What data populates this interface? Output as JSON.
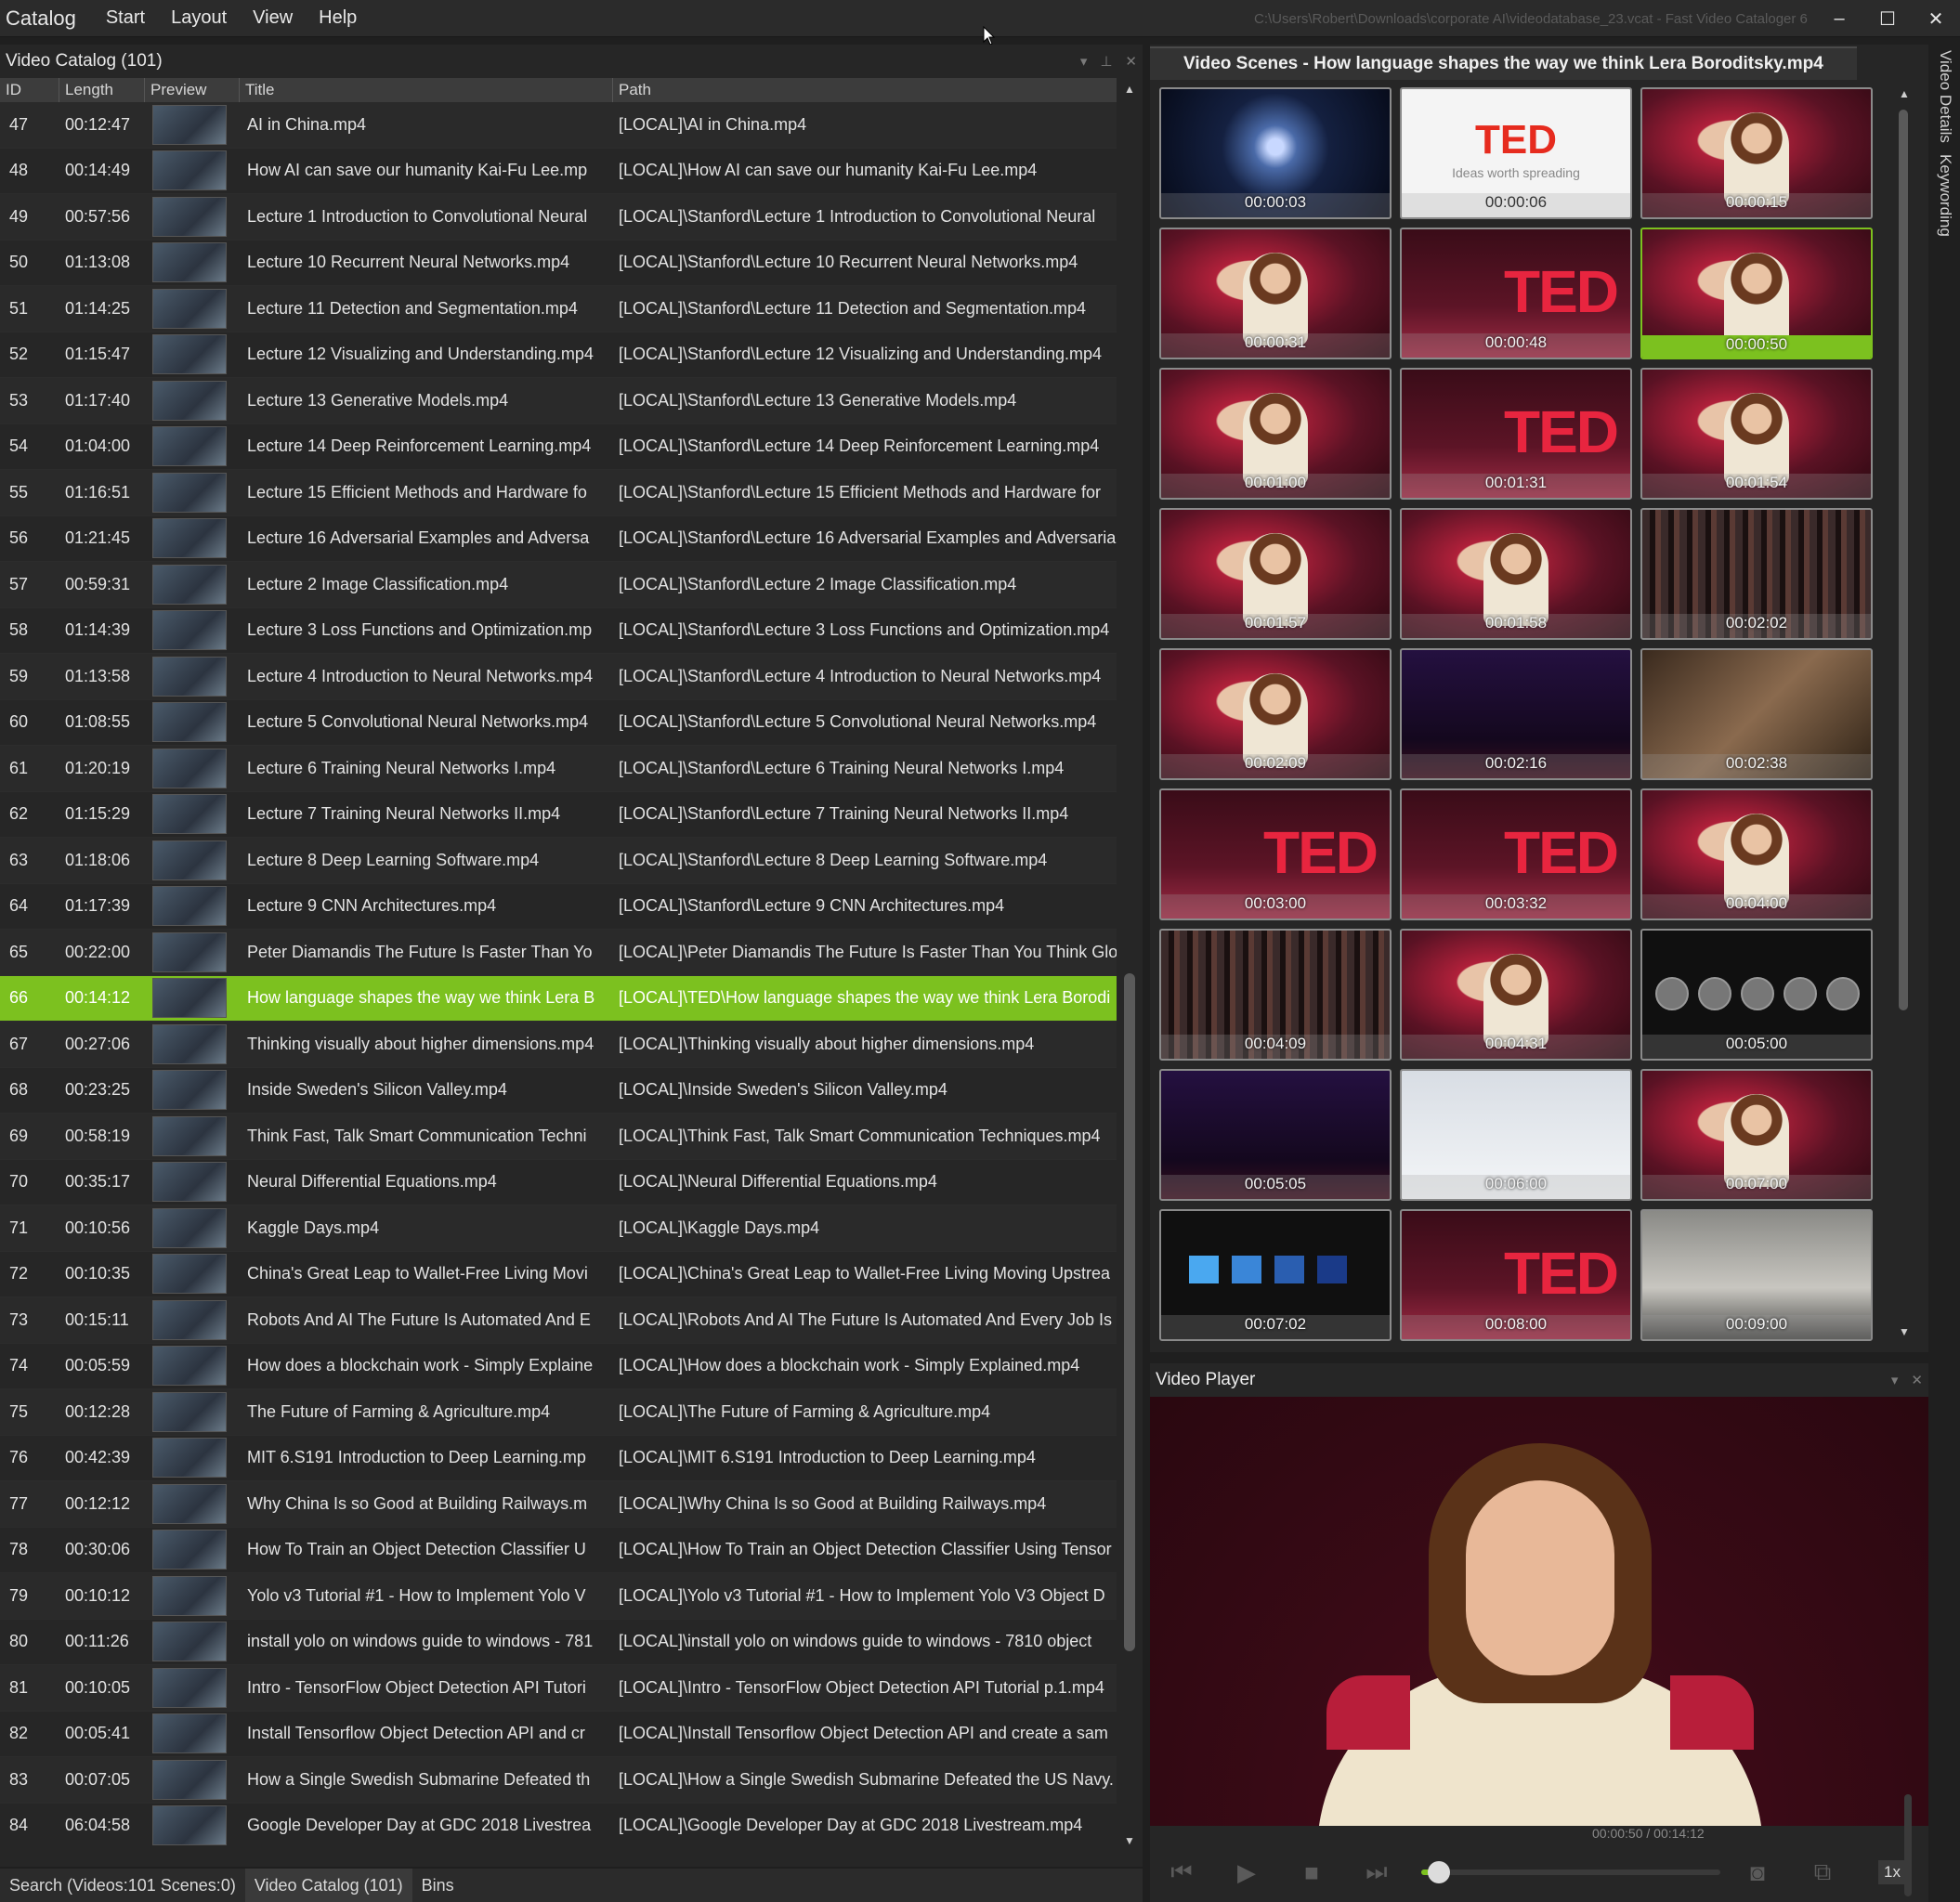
{
  "menu": {
    "items": [
      "Catalog",
      "Start",
      "Layout",
      "View",
      "Help"
    ]
  },
  "window": {
    "title_path": "C:\\Users\\Robert\\Downloads\\corporate AI\\videodatabase_23.vcat - Fast Video Cataloger 6",
    "minimize": "–",
    "maximize": "☐",
    "close": "✕"
  },
  "catalog": {
    "title": "Video Catalog (101)",
    "columns": [
      "ID",
      "Length",
      "Preview",
      "Title",
      "Path"
    ],
    "rows": [
      {
        "id": "47",
        "length": "00:12:47",
        "title": "AI in China.mp4",
        "path": "[LOCAL]\\AI in China.mp4"
      },
      {
        "id": "48",
        "length": "00:14:49",
        "title": "How AI can save our humanity Kai-Fu Lee.mp",
        "path": "[LOCAL]\\How AI can save our humanity Kai-Fu Lee.mp4"
      },
      {
        "id": "49",
        "length": "00:57:56",
        "title": "Lecture 1 Introduction to Convolutional Neural",
        "path": "[LOCAL]\\Stanford\\Lecture 1 Introduction to Convolutional Neural"
      },
      {
        "id": "50",
        "length": "01:13:08",
        "title": "Lecture 10 Recurrent Neural Networks.mp4",
        "path": "[LOCAL]\\Stanford\\Lecture 10 Recurrent Neural Networks.mp4"
      },
      {
        "id": "51",
        "length": "01:14:25",
        "title": "Lecture 11 Detection and Segmentation.mp4",
        "path": "[LOCAL]\\Stanford\\Lecture 11 Detection and Segmentation.mp4"
      },
      {
        "id": "52",
        "length": "01:15:47",
        "title": "Lecture 12 Visualizing and Understanding.mp4",
        "path": "[LOCAL]\\Stanford\\Lecture 12 Visualizing and Understanding.mp4"
      },
      {
        "id": "53",
        "length": "01:17:40",
        "title": "Lecture 13 Generative Models.mp4",
        "path": "[LOCAL]\\Stanford\\Lecture 13 Generative Models.mp4"
      },
      {
        "id": "54",
        "length": "01:04:00",
        "title": "Lecture 14 Deep Reinforcement Learning.mp4",
        "path": "[LOCAL]\\Stanford\\Lecture 14 Deep Reinforcement Learning.mp4"
      },
      {
        "id": "55",
        "length": "01:16:51",
        "title": "Lecture 15 Efficient Methods and Hardware fo",
        "path": "[LOCAL]\\Stanford\\Lecture 15 Efficient Methods and Hardware for"
      },
      {
        "id": "56",
        "length": "01:21:45",
        "title": "Lecture 16 Adversarial Examples and Adversa",
        "path": "[LOCAL]\\Stanford\\Lecture 16 Adversarial Examples and Adversaria"
      },
      {
        "id": "57",
        "length": "00:59:31",
        "title": "Lecture 2 Image Classification.mp4",
        "path": "[LOCAL]\\Stanford\\Lecture 2 Image Classification.mp4"
      },
      {
        "id": "58",
        "length": "01:14:39",
        "title": "Lecture 3 Loss Functions and Optimization.mp",
        "path": "[LOCAL]\\Stanford\\Lecture 3 Loss Functions and Optimization.mp4"
      },
      {
        "id": "59",
        "length": "01:13:58",
        "title": "Lecture 4 Introduction to Neural Networks.mp4",
        "path": "[LOCAL]\\Stanford\\Lecture 4 Introduction to Neural Networks.mp4"
      },
      {
        "id": "60",
        "length": "01:08:55",
        "title": "Lecture 5 Convolutional Neural Networks.mp4",
        "path": "[LOCAL]\\Stanford\\Lecture 5 Convolutional Neural Networks.mp4"
      },
      {
        "id": "61",
        "length": "01:20:19",
        "title": "Lecture 6 Training Neural Networks I.mp4",
        "path": "[LOCAL]\\Stanford\\Lecture 6 Training Neural Networks I.mp4"
      },
      {
        "id": "62",
        "length": "01:15:29",
        "title": "Lecture 7 Training Neural Networks II.mp4",
        "path": "[LOCAL]\\Stanford\\Lecture 7 Training Neural Networks II.mp4"
      },
      {
        "id": "63",
        "length": "01:18:06",
        "title": "Lecture 8 Deep Learning Software.mp4",
        "path": "[LOCAL]\\Stanford\\Lecture 8 Deep Learning Software.mp4"
      },
      {
        "id": "64",
        "length": "01:17:39",
        "title": "Lecture 9 CNN Architectures.mp4",
        "path": "[LOCAL]\\Stanford\\Lecture 9 CNN Architectures.mp4"
      },
      {
        "id": "65",
        "length": "00:22:00",
        "title": "Peter Diamandis The Future Is Faster Than Yo",
        "path": "[LOCAL]\\Peter Diamandis The Future Is Faster Than You Think Glo"
      },
      {
        "id": "66",
        "length": "00:14:12",
        "title": "How language shapes the way we think Lera B",
        "path": "[LOCAL]\\TED\\How language shapes the way we think Lera Borodi"
      },
      {
        "id": "67",
        "length": "00:27:06",
        "title": "Thinking visually about higher dimensions.mp4",
        "path": "[LOCAL]\\Thinking visually about higher dimensions.mp4"
      },
      {
        "id": "68",
        "length": "00:23:25",
        "title": "Inside Sweden's Silicon Valley.mp4",
        "path": "[LOCAL]\\Inside Sweden's Silicon Valley.mp4"
      },
      {
        "id": "69",
        "length": "00:58:19",
        "title": "Think Fast, Talk Smart Communication Techni",
        "path": "[LOCAL]\\Think Fast, Talk Smart Communication Techniques.mp4"
      },
      {
        "id": "70",
        "length": "00:35:17",
        "title": "Neural Differential Equations.mp4",
        "path": "[LOCAL]\\Neural Differential Equations.mp4"
      },
      {
        "id": "71",
        "length": "00:10:56",
        "title": "Kaggle Days.mp4",
        "path": "[LOCAL]\\Kaggle Days.mp4"
      },
      {
        "id": "72",
        "length": "00:10:35",
        "title": "China's Great Leap to Wallet-Free Living Movi",
        "path": "[LOCAL]\\China's Great Leap to Wallet-Free Living Moving Upstrea"
      },
      {
        "id": "73",
        "length": "00:15:11",
        "title": "Robots And AI The Future Is Automated And E",
        "path": "[LOCAL]\\Robots And AI The Future Is Automated And Every Job Is"
      },
      {
        "id": "74",
        "length": "00:05:59",
        "title": "How does a blockchain work - Simply Explaine",
        "path": "[LOCAL]\\How does a blockchain work - Simply Explained.mp4"
      },
      {
        "id": "75",
        "length": "00:12:28",
        "title": "The Future of Farming & Agriculture.mp4",
        "path": "[LOCAL]\\The Future of Farming & Agriculture.mp4"
      },
      {
        "id": "76",
        "length": "00:42:39",
        "title": "MIT 6.S191 Introduction to Deep Learning.mp",
        "path": "[LOCAL]\\MIT 6.S191 Introduction to Deep Learning.mp4"
      },
      {
        "id": "77",
        "length": "00:12:12",
        "title": "Why China Is so Good at Building Railways.m",
        "path": "[LOCAL]\\Why China Is so Good at Building Railways.mp4"
      },
      {
        "id": "78",
        "length": "00:30:06",
        "title": "How To Train an Object Detection Classifier U",
        "path": "[LOCAL]\\How To Train an Object Detection Classifier Using Tensor"
      },
      {
        "id": "79",
        "length": "00:10:12",
        "title": "Yolo v3 Tutorial #1 - How to Implement Yolo V",
        "path": "[LOCAL]\\Yolo v3 Tutorial #1 - How to Implement Yolo V3 Object D"
      },
      {
        "id": "80",
        "length": "00:11:26",
        "title": "install yolo on windows guide to windows - 781",
        "path": "[LOCAL]\\install yolo on windows guide to windows - 7810 object"
      },
      {
        "id": "81",
        "length": "00:10:05",
        "title": "Intro - TensorFlow Object Detection API Tutori",
        "path": "[LOCAL]\\Intro - TensorFlow Object Detection API Tutorial p.1.mp4"
      },
      {
        "id": "82",
        "length": "00:05:41",
        "title": "Install Tensorflow Object Detection API and cr",
        "path": "[LOCAL]\\Install Tensorflow Object Detection API and create a sam"
      },
      {
        "id": "83",
        "length": "00:07:05",
        "title": "How a Single Swedish Submarine Defeated th",
        "path": "[LOCAL]\\How a Single Swedish Submarine Defeated the US Navy."
      },
      {
        "id": "84",
        "length": "06:04:58",
        "title": "Google Developer Day at GDC 2018 Livestrea",
        "path": "[LOCAL]\\Google Developer Day at GDC 2018 Livestream.mp4"
      }
    ],
    "selected_id": "66"
  },
  "bottom_tabs": [
    "Search (Videos:101 Scenes:0)",
    "Video Catalog (101)",
    "Bins"
  ],
  "scenes": {
    "title": "Video Scenes - How language shapes the way we think Lera Boroditsky.mp4",
    "ted_logo": "TED",
    "ted_tagline": "Ideas worth spreading",
    "items": [
      {
        "time": "00:00:03",
        "kind": "space"
      },
      {
        "time": "00:00:06",
        "kind": "white"
      },
      {
        "time": "00:00:15",
        "kind": "stage"
      },
      {
        "time": "00:00:31",
        "kind": "stage"
      },
      {
        "time": "00:00:48",
        "kind": "ted"
      },
      {
        "time": "00:00:50",
        "kind": "stage",
        "selected": true
      },
      {
        "time": "00:01:00",
        "kind": "stage"
      },
      {
        "time": "00:01:31",
        "kind": "ted"
      },
      {
        "time": "00:01:54",
        "kind": "stage"
      },
      {
        "time": "00:01:57",
        "kind": "stage"
      },
      {
        "time": "00:01:58",
        "kind": "stage"
      },
      {
        "time": "00:02:02",
        "kind": "crowd"
      },
      {
        "time": "00:02:09",
        "kind": "stage"
      },
      {
        "time": "00:02:16",
        "kind": "purple"
      },
      {
        "time": "00:02:38",
        "kind": "faces"
      },
      {
        "time": "00:03:00",
        "kind": "ted"
      },
      {
        "time": "00:03:32",
        "kind": "ted"
      },
      {
        "time": "00:04:00",
        "kind": "stage"
      },
      {
        "time": "00:04:09",
        "kind": "crowd"
      },
      {
        "time": "00:04:31",
        "kind": "stage"
      },
      {
        "time": "00:05:00",
        "kind": "circles"
      },
      {
        "time": "00:05:05",
        "kind": "purple"
      },
      {
        "time": "00:06:00",
        "kind": "snow"
      },
      {
        "time": "00:07:00",
        "kind": "stage"
      },
      {
        "time": "00:07:02",
        "kind": "squares"
      },
      {
        "time": "00:08:00",
        "kind": "ted"
      },
      {
        "time": "00:09:00",
        "kind": "museum"
      }
    ]
  },
  "side_tabs": [
    "Video Details",
    "Keywording"
  ],
  "player": {
    "title": "Video Player",
    "time_readout": "00:00:50 / 00:14:12",
    "progress_fraction": 0.059,
    "speed": "1x"
  },
  "colors": {
    "accent": "#7cc11f",
    "ted_red": "#e8253f"
  }
}
